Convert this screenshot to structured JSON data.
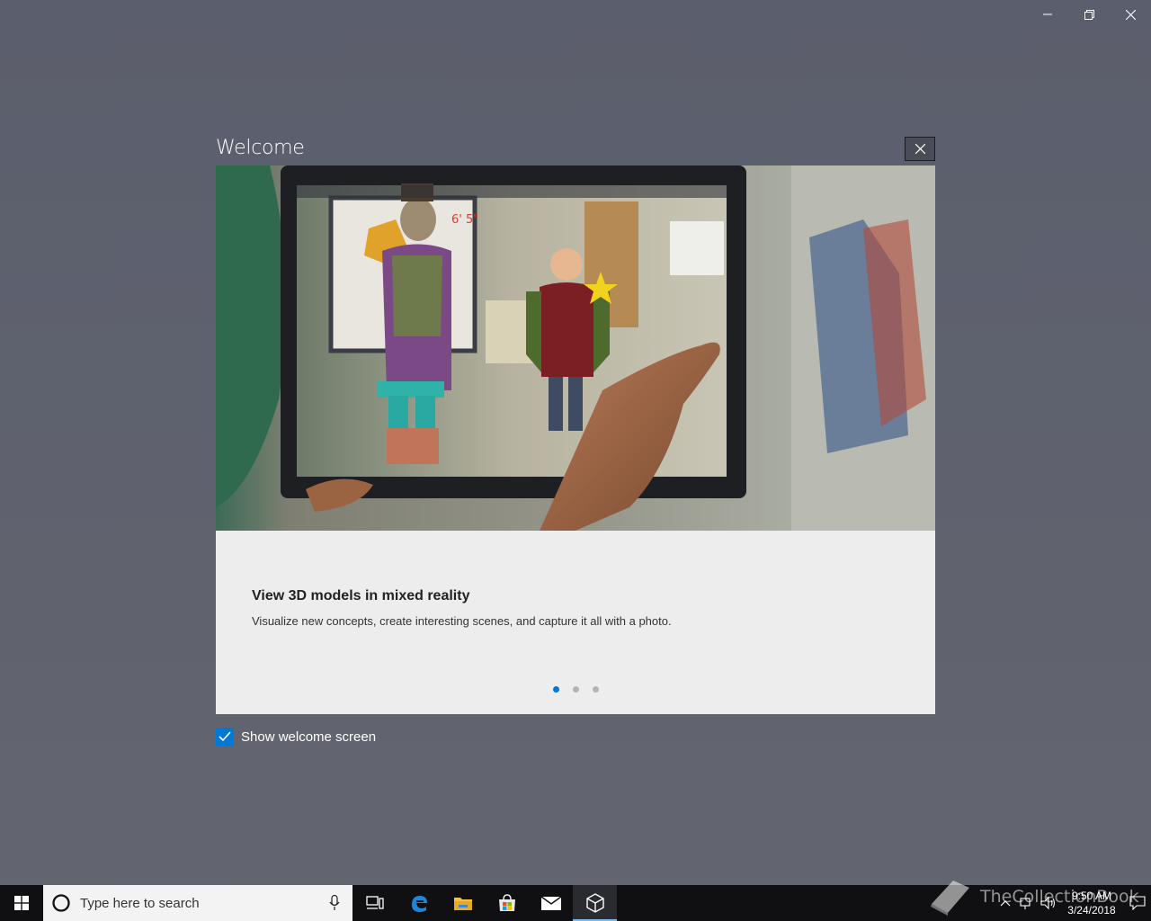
{
  "window": {
    "caption": {
      "minimize_icon": "minimize-icon",
      "restore_icon": "restore-icon",
      "close_icon": "close-icon"
    }
  },
  "dialog": {
    "title": "Welcome",
    "close_icon": "close-icon",
    "slide": {
      "title": "View 3D models in mixed reality",
      "description": "Visualize new concepts, create interesting scenes, and capture it all with a photo."
    },
    "pagination": {
      "count": 3,
      "active_index": 0
    },
    "show_welcome": {
      "label": "Show welcome screen",
      "checked": true
    }
  },
  "taskbar": {
    "search_placeholder": "Type here to search",
    "pinned": [
      "task-view-icon",
      "edge-icon",
      "file-explorer-icon",
      "store-icon",
      "mail-icon",
      "mixed-reality-viewer-icon"
    ],
    "active_app": "mixed-reality-viewer-icon",
    "clock": {
      "time": "9:50 AM",
      "date": "3/24/2018"
    }
  },
  "watermark": {
    "text": "TheCollectionBook"
  },
  "colors": {
    "accent": "#0078d7",
    "taskbar": "#101012",
    "panel": "#ededee"
  }
}
